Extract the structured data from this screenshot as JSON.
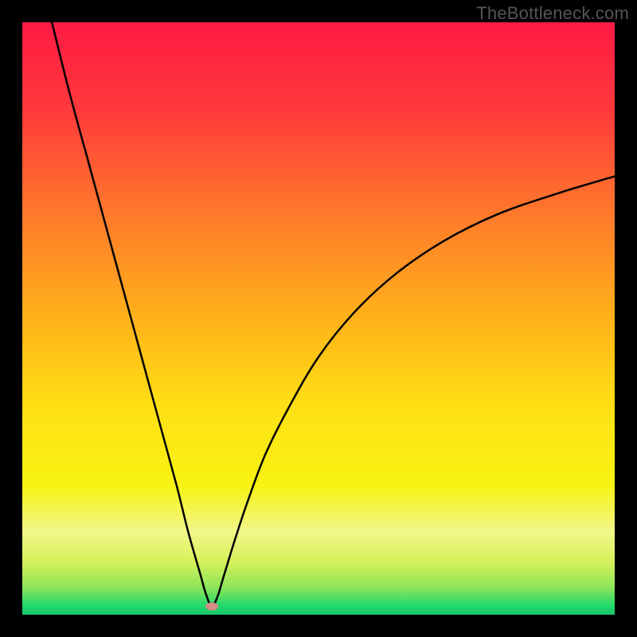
{
  "watermark": "TheBottleneck.com",
  "colors": {
    "gradient_stops": [
      {
        "offset": 0.0,
        "color": "#ff1a44"
      },
      {
        "offset": 0.15,
        "color": "#ff3a3c"
      },
      {
        "offset": 0.33,
        "color": "#ff7b2a"
      },
      {
        "offset": 0.5,
        "color": "#ffb21a"
      },
      {
        "offset": 0.65,
        "color": "#ffe014"
      },
      {
        "offset": 0.78,
        "color": "#f7f312"
      },
      {
        "offset": 0.86,
        "color": "#f2f78a"
      },
      {
        "offset": 0.91,
        "color": "#d6f25a"
      },
      {
        "offset": 0.955,
        "color": "#8ce45a"
      },
      {
        "offset": 0.985,
        "color": "#20d96c"
      },
      {
        "offset": 1.0,
        "color": "#18c76a"
      }
    ],
    "curve": "#000000",
    "marker": "#d68b85",
    "frame": "#000000"
  },
  "chart_data": {
    "type": "line",
    "title": "",
    "xlabel": "",
    "ylabel": "",
    "xlim": [
      0,
      100
    ],
    "ylim": [
      0,
      100
    ],
    "min_point": {
      "x": 32,
      "y": 1.4
    },
    "series": [
      {
        "name": "bottleneck-curve",
        "x": [
          5,
          8,
          11,
          14,
          17,
          20,
          23,
          26,
          28,
          30,
          31,
          32,
          33,
          34,
          36,
          38,
          41,
          45,
          50,
          56,
          63,
          71,
          80,
          90,
          100
        ],
        "y": [
          100,
          88,
          77,
          66,
          55,
          44,
          33,
          22,
          14,
          7,
          3.5,
          1.4,
          3.2,
          6.5,
          13,
          19,
          27,
          35,
          43.5,
          51,
          57.5,
          63,
          67.5,
          71,
          74
        ]
      }
    ]
  }
}
